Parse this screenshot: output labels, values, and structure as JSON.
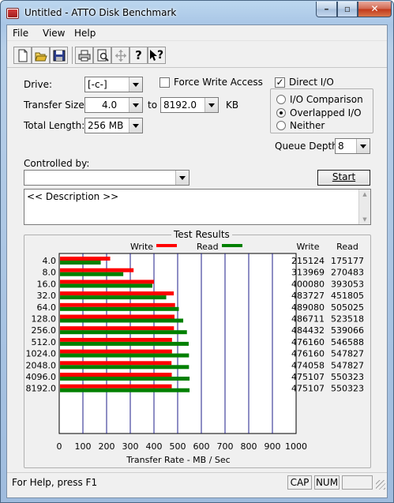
{
  "window": {
    "title": "Untitled - ATTO Disk Benchmark",
    "min_glyph": "–",
    "max_glyph": "▫",
    "close_glyph": "✕"
  },
  "menu": {
    "file": "File",
    "view": "View",
    "help": "Help"
  },
  "toolbar": {
    "buttons": [
      "new-icon",
      "open-icon",
      "save-icon",
      "print-icon",
      "print-preview-icon",
      "move-icon",
      "help-icon",
      "context-help-icon"
    ],
    "help_glyph": "?",
    "context_help_glyph": "?"
  },
  "form": {
    "drive_label": "Drive:",
    "drive_value": "[-c-]",
    "force_write_label": "Force Write Access",
    "force_write_checked": false,
    "direct_io_label": "Direct I/O",
    "direct_io_checked": true,
    "direct_io_mark": "✓",
    "transfer_size_label": "Transfer Size:",
    "transfer_from": "4.0",
    "to_label": "to",
    "transfer_to": "8192.0",
    "kb_label": "KB",
    "total_length_label": "Total Length:",
    "total_length_value": "256 MB",
    "io_comparison_label": "I/O Comparison",
    "overlapped_io_label": "Overlapped I/O",
    "neither_label": "Neither",
    "selected_io_mode": "Overlapped I/O",
    "queue_depth_label": "Queue Depth:",
    "queue_depth_value": "8",
    "controlled_by_label": "Controlled by:",
    "controlled_by_value": "",
    "start_label": "Start",
    "description": "<< Description >>",
    "scroll_up_glyph": "▲",
    "scroll_down_glyph": "▼"
  },
  "results": {
    "title": "Test Results",
    "write_legend": "Write",
    "read_legend": "Read",
    "write_col_header": "Write",
    "read_col_header": "Read",
    "write_color": "#ff0000",
    "read_color": "#008000"
  },
  "chart_data": {
    "type": "bar",
    "orientation": "horizontal",
    "title": "Test Results",
    "xlabel": "Transfer Rate - MB / Sec",
    "ylabel": "",
    "xlim": [
      0,
      1000
    ],
    "x_ticks": [
      0,
      100,
      200,
      300,
      400,
      500,
      600,
      700,
      800,
      900,
      1000
    ],
    "grid": true,
    "legend": "top",
    "categories": [
      "4.0",
      "8.0",
      "16.0",
      "32.0",
      "64.0",
      "128.0",
      "256.0",
      "512.0",
      "1024.0",
      "2048.0",
      "4096.0",
      "8192.0"
    ],
    "series": [
      {
        "name": "Write",
        "color": "#ff0000",
        "values": [
          215124,
          313969,
          400080,
          483727,
          489080,
          486711,
          484432,
          476160,
          476160,
          474058,
          475107,
          475107
        ]
      },
      {
        "name": "Read",
        "color": "#008000",
        "values": [
          175177,
          270483,
          393053,
          451805,
          505025,
          523518,
          539066,
          546588,
          547827,
          547827,
          550323,
          550323
        ]
      }
    ],
    "value_unit_divisor": 1000
  },
  "status": {
    "text": "For Help, press F1",
    "cap": "CAP",
    "num": "NUM"
  }
}
